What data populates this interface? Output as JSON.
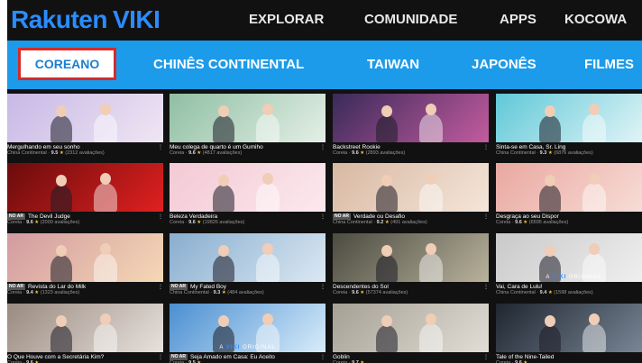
{
  "brand": {
    "name": "Rakuten",
    "product": "VIKI"
  },
  "topnav": [
    "EXPLORAR",
    "COMUNIDADE",
    "APPS",
    "KOCOWA"
  ],
  "categories": [
    "COREANO",
    "CHINÊS CONTINENTAL",
    "TAIWAN",
    "JAPONÊS",
    "FILMES"
  ],
  "colors": {
    "accent": "#1c9bea",
    "brand": "#2a8cff",
    "highlight": "#d52a2a",
    "star": "#f2c230"
  },
  "cards": [
    {
      "title": "Mergulhando em seu sonho",
      "country": "China Continental",
      "score": "9.5",
      "reviews": "(2312 avaliações)",
      "badge": "",
      "original": false,
      "bg": [
        "#c7b8e6",
        "#efe6f3"
      ]
    },
    {
      "title": "Meu colega de quarto é um Gumiho",
      "country": "Coreia",
      "score": "9.6",
      "reviews": "(4817 avaliações)",
      "badge": "",
      "original": false,
      "bg": [
        "#8fbfa3",
        "#e4efe6"
      ]
    },
    {
      "title": "Backstreet Rookie",
      "country": "Coreia",
      "score": "9.6",
      "reviews": "(2893 avaliações)",
      "badge": "",
      "original": false,
      "bg": [
        "#3a2a5a",
        "#c35b9e"
      ]
    },
    {
      "title": "Sinta-se em Casa, Sr. Ling",
      "country": "China Continental",
      "score": "9.3",
      "reviews": "(6876 avaliações)",
      "badge": "",
      "original": false,
      "bg": [
        "#5fc8d8",
        "#e7f6f8"
      ]
    },
    {
      "title": "The Devil Judge",
      "country": "Coreia",
      "score": "9.6",
      "reviews": "(2000 avaliações)",
      "badge": "NO AR",
      "original": false,
      "bg": [
        "#6a0c0c",
        "#e02020"
      ]
    },
    {
      "title": "Beleza Verdadeira",
      "country": "Coreia",
      "score": "9.6",
      "reviews": "(19826 avaliações)",
      "badge": "",
      "original": false,
      "bg": [
        "#f3c9d4",
        "#fbe9ee"
      ]
    },
    {
      "title": "Verdade ou Desafio",
      "country": "China Continental",
      "score": "9.2",
      "reviews": "(491 avaliações)",
      "badge": "NO AR",
      "original": false,
      "bg": [
        "#d8b8a2",
        "#f4e6da"
      ]
    },
    {
      "title": "Desgraça ao seu Dispor",
      "country": "Coreia",
      "score": "9.6",
      "reviews": "(6595 avaliações)",
      "badge": "",
      "original": false,
      "bg": [
        "#e9a8a0",
        "#f8dfd9"
      ]
    },
    {
      "title": "Revista do Lar do Milk",
      "country": "Coreia",
      "score": "9.4",
      "reviews": "(1323 avaliações)",
      "badge": "NO AR",
      "original": false,
      "bg": [
        "#d29aa0",
        "#f5d8b5"
      ]
    },
    {
      "title": "My Fated Boy",
      "country": "China Continental",
      "score": "9.3",
      "reviews": "(484 avaliações)",
      "badge": "NO AR",
      "original": false,
      "bg": [
        "#89aecf",
        "#dbe8f3"
      ]
    },
    {
      "title": "Descendentes do Sol",
      "country": "Coreia",
      "score": "9.6",
      "reviews": "(57374 avaliações)",
      "badge": "",
      "original": false,
      "bg": [
        "#4b4b40",
        "#b9b29c"
      ]
    },
    {
      "title": "Vai, Cara de Lulu!",
      "country": "China Continental",
      "score": "9.4",
      "reviews": "(1598 avaliações)",
      "badge": "",
      "original": true,
      "bg": [
        "#c9c9c9",
        "#f1f1f1"
      ]
    },
    {
      "title": "O Que Houve com a Secretária Kim?",
      "country": "Coreia",
      "score": "9.6",
      "reviews": "",
      "badge": "",
      "original": false,
      "bg": [
        "#9a8a80",
        "#e7e1dc"
      ]
    },
    {
      "title": "Seja Amado em Casa: Eu Aceito",
      "country": "Coreia",
      "score": "9.5",
      "reviews": "",
      "badge": "NO AR",
      "original": true,
      "bg": [
        "#4b8fd1",
        "#d8ecfa"
      ]
    },
    {
      "title": "Goblin",
      "country": "Coreia",
      "score": "9.7",
      "reviews": "",
      "badge": "",
      "original": false,
      "bg": [
        "#a4a094",
        "#e2ded6"
      ]
    },
    {
      "title": "Tale of the Nine-Tailed",
      "country": "Coreia",
      "score": "9.6",
      "reviews": "",
      "badge": "",
      "original": false,
      "bg": [
        "#1f2630",
        "#7d8a9a"
      ]
    }
  ],
  "labels": {
    "original_prefix": "A",
    "original_brand": "VIKI",
    "original_suffix": "ORIGINAL",
    "star": "★",
    "dots": "⋮",
    "separator": "·"
  }
}
